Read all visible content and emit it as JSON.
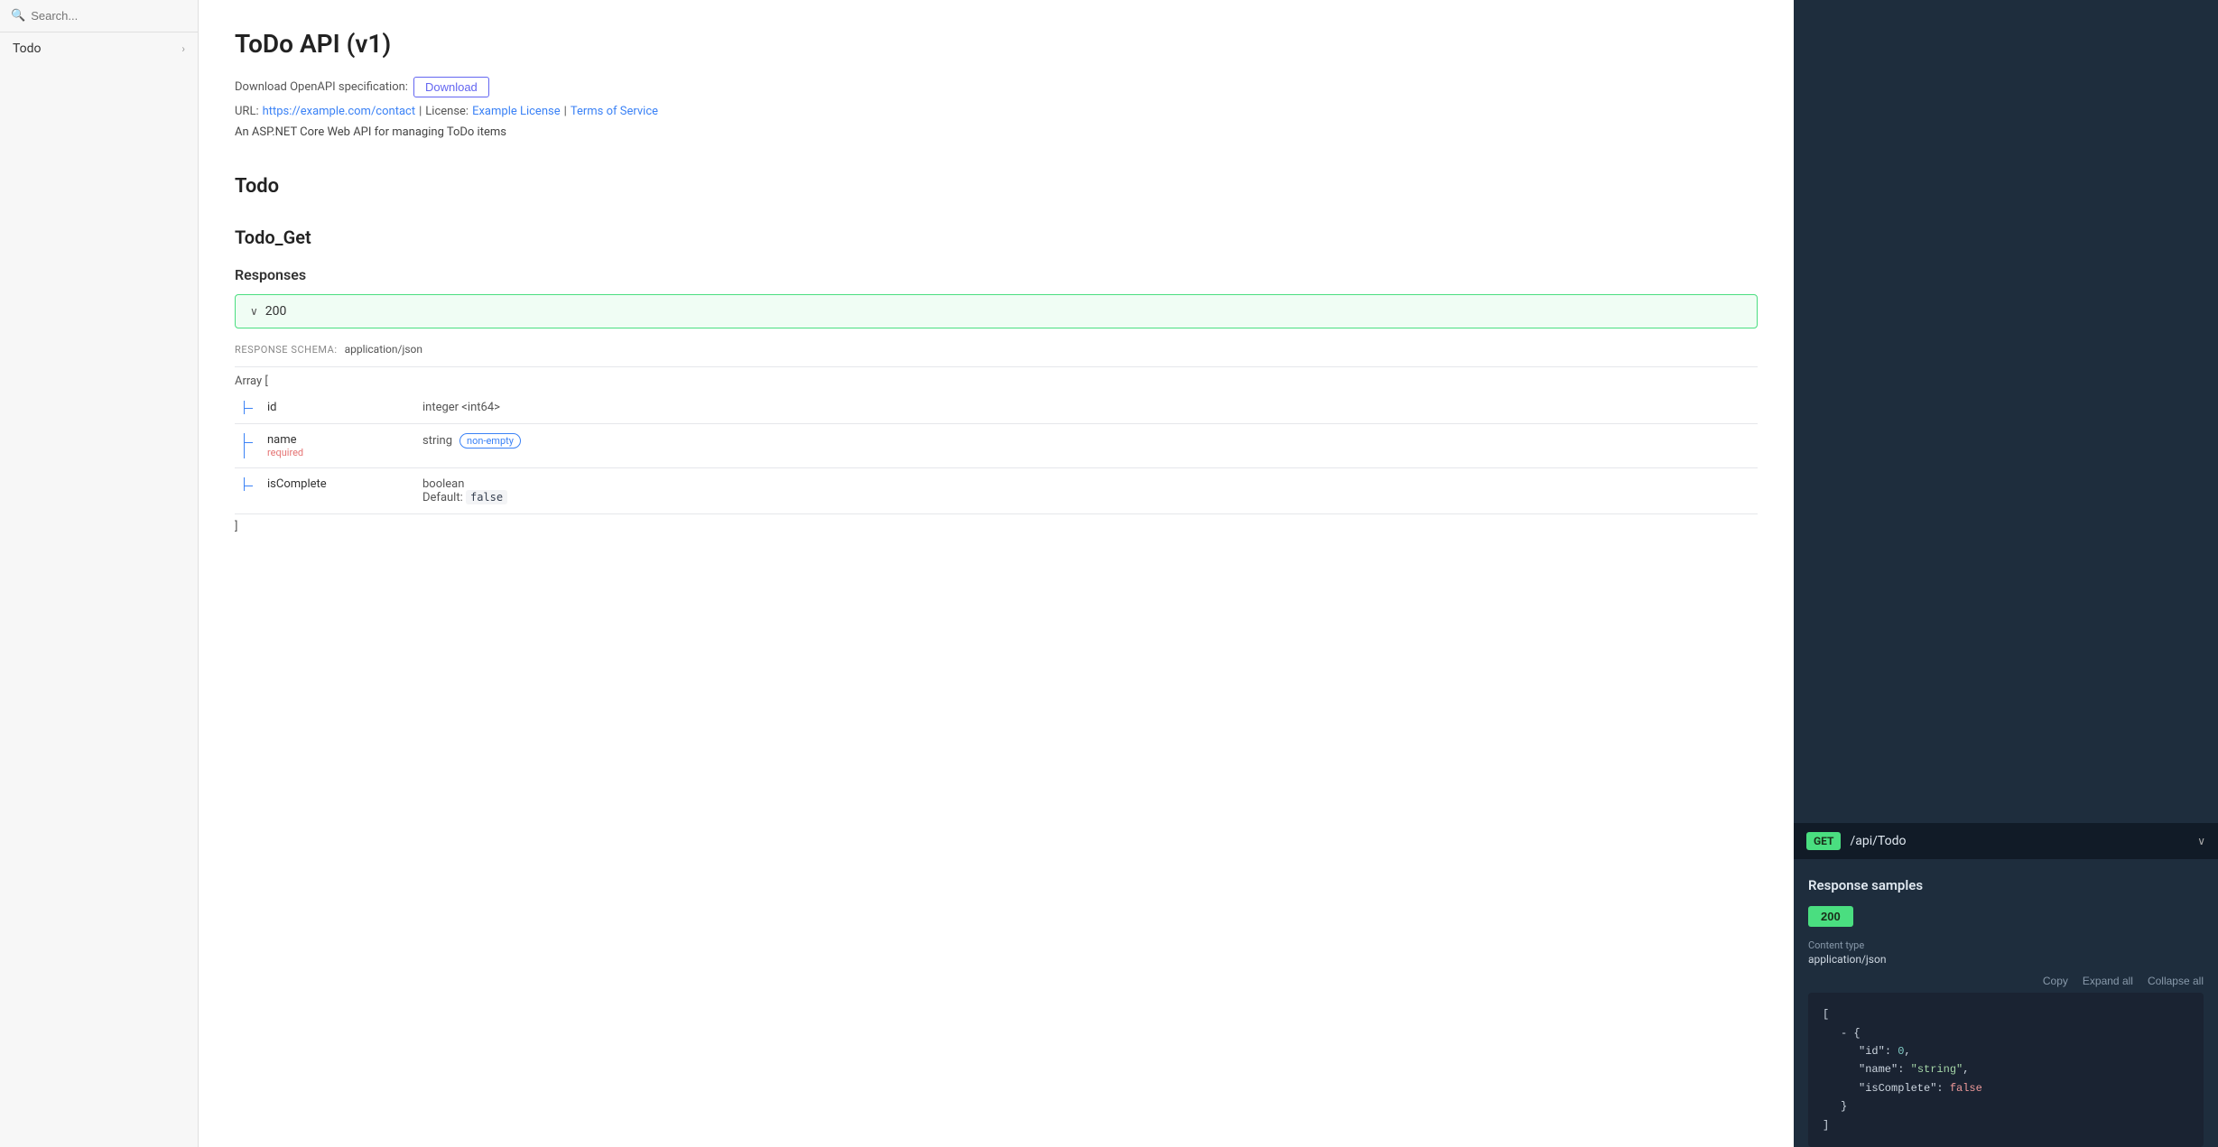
{
  "sidebar": {
    "search_placeholder": "Search...",
    "items": [
      {
        "label": "Todo",
        "has_chevron": true
      }
    ]
  },
  "main": {
    "page_title": "ToDo API (v1)",
    "download_spec_label": "Download OpenAPI specification:",
    "download_button_label": "Download",
    "url_label": "URL:",
    "url_value": "https://example.com/contact",
    "license_label": "License:",
    "license_link": "Example License",
    "terms_link": "Terms of Service",
    "description": "An ASP.NET Core Web API for managing ToDo items",
    "section_title": "Todo",
    "endpoint_title": "Todo_Get",
    "responses_title": "Responses",
    "response_code": "200",
    "response_schema_label": "RESPONSE SCHEMA:",
    "response_schema_type": "application/json",
    "array_label": "Array [",
    "array_close": "]",
    "fields": [
      {
        "name": "id",
        "required": false,
        "type": "integer <int64>",
        "badge": null,
        "default_label": null,
        "default_value": null
      },
      {
        "name": "name",
        "required": true,
        "required_label": "required",
        "type": "string",
        "badge": "non-empty",
        "default_label": null,
        "default_value": null
      },
      {
        "name": "isComplete",
        "required": false,
        "type": "boolean",
        "badge": null,
        "default_label": "Default:",
        "default_value": "false"
      }
    ]
  },
  "right_panel": {
    "endpoint": {
      "method": "GET",
      "path": "/api/Todo"
    },
    "response_samples_title": "Response samples",
    "status_tab": "200",
    "content_type_label": "Content type",
    "content_type_value": "application/json",
    "copy_label": "Copy",
    "expand_label": "Expand all",
    "collapse_label": "Collapse all",
    "code": [
      {
        "indent": 0,
        "text": "[",
        "type": "bracket"
      },
      {
        "indent": 1,
        "text": "- {",
        "type": "brace"
      },
      {
        "indent": 2,
        "key": "\"id\"",
        "separator": ": ",
        "value": "0",
        "value_type": "number"
      },
      {
        "indent": 2,
        "key": "\"name\"",
        "separator": ": ",
        "value": "\"string\"",
        "value_type": "string"
      },
      {
        "indent": 2,
        "key": "\"isComplete\"",
        "separator": ": ",
        "value": "false",
        "value_type": "bool"
      },
      {
        "indent": 1,
        "text": "}",
        "type": "brace"
      },
      {
        "indent": 0,
        "text": "]",
        "type": "bracket"
      }
    ]
  }
}
